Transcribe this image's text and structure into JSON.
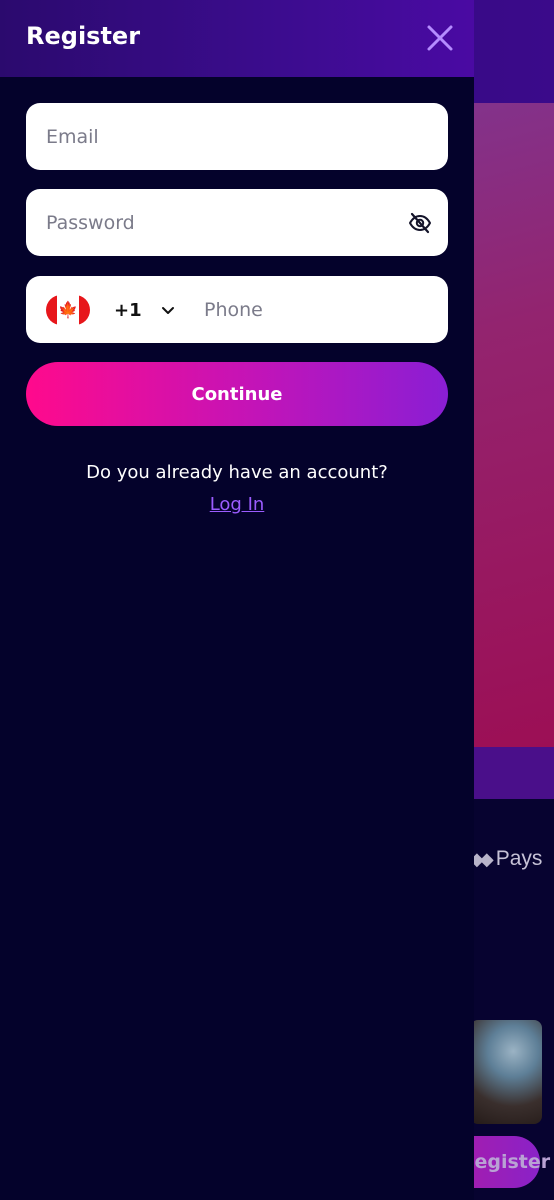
{
  "colors": {
    "drawer_bg": "#04022b",
    "header_gradient_start": "#2b0a6e",
    "header_gradient_end": "#4a0aa3",
    "accent_pink": "#ff0a8c",
    "accent_purple": "#8a1ed4",
    "link": "#9b5cff",
    "close_icon": "#b58cff"
  },
  "drawer": {
    "title": "Register",
    "close_icon": "close-icon"
  },
  "form": {
    "email": {
      "placeholder": "Email",
      "value": ""
    },
    "password": {
      "placeholder": "Password",
      "value": "",
      "toggle_icon": "eye-off-icon"
    },
    "phone": {
      "country_flag": "canada-flag-icon",
      "dial_code": "+1",
      "dropdown_icon": "chevron-down-icon",
      "placeholder": "Phone",
      "value": ""
    },
    "continue_label": "Continue"
  },
  "footer": {
    "question": "Do you already have an account?",
    "login_label": "Log In"
  },
  "background": {
    "payment_text": "Pays",
    "register_button": "Register"
  }
}
